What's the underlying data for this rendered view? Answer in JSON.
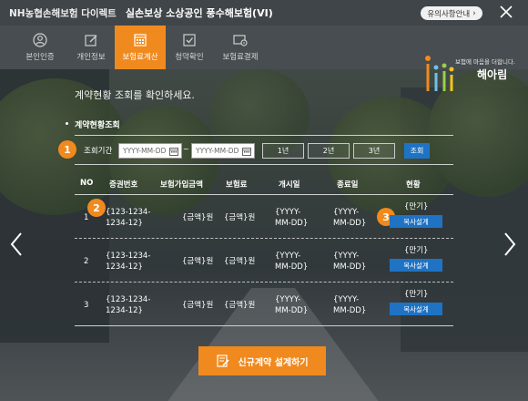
{
  "topbar": {
    "brand": "NH농협손해보험 다이렉트",
    "title": "실손보상 소상공인 풍수해보험(VI)",
    "notice_label": "유의사항안내",
    "notice_arrow": "›"
  },
  "steps": [
    {
      "label": "본인인증",
      "icon": "person-icon"
    },
    {
      "label": "개인정보",
      "icon": "edit-icon"
    },
    {
      "label": "보험료계산",
      "icon": "calculator-icon",
      "active": true
    },
    {
      "label": "청약확인",
      "icon": "check-icon"
    },
    {
      "label": "보험료결제",
      "icon": "payment-icon"
    }
  ],
  "logo": {
    "tagline": "보험에 마음을 더합니다.",
    "name": "해아림"
  },
  "subtitle": "계약현황 조회를 확인하세요.",
  "section_title": "계약현황조회",
  "search": {
    "label": "조회기간",
    "start_placeholder": "YYYY-MM-DD",
    "end_placeholder": "YYYY-MM-DD",
    "tilde": "~",
    "periods": [
      "1년",
      "2년",
      "3년"
    ],
    "search_label": "조회"
  },
  "badges": [
    "1",
    "2",
    "3"
  ],
  "table": {
    "headers": [
      "NO",
      "증권번호",
      "보험가입금액",
      "보험료",
      "개시일",
      "종료일",
      "현황"
    ],
    "rows": [
      {
        "no": "1",
        "policy_line1": "{123-1234-",
        "policy_line2": "1234-12}",
        "amount": "{금액}원",
        "premium": "{금액}원",
        "start_line1": "{YYYY-",
        "start_line2": "MM-DD}",
        "end_line1": "{YYYY-",
        "end_line2": "MM-DD}",
        "status": "{만기}",
        "action": "복사설계"
      },
      {
        "no": "2",
        "policy_line1": "{123-1234-",
        "policy_line2": "1234-12}",
        "amount": "{금액}원",
        "premium": "{금액}원",
        "start_line1": "{YYYY-",
        "start_line2": "MM-DD}",
        "end_line1": "{YYYY-",
        "end_line2": "MM-DD}",
        "status": "{만기}",
        "action": "복사설계"
      },
      {
        "no": "3",
        "policy_line1": "{123-1234-",
        "policy_line2": "1234-12}",
        "amount": "{금액}원",
        "premium": "{금액}원",
        "start_line1": "{YYYY-",
        "start_line2": "MM-DD}",
        "end_line1": "{YYYY-",
        "end_line2": "MM-DD}",
        "status": "{만기}",
        "action": "복사설계"
      }
    ]
  },
  "cta_label": "신규계약 설계하기",
  "colors": {
    "accent": "#f08a1e",
    "primary_button": "#1f73c4",
    "topbar": "#3f4548",
    "nav": "#474d50"
  }
}
